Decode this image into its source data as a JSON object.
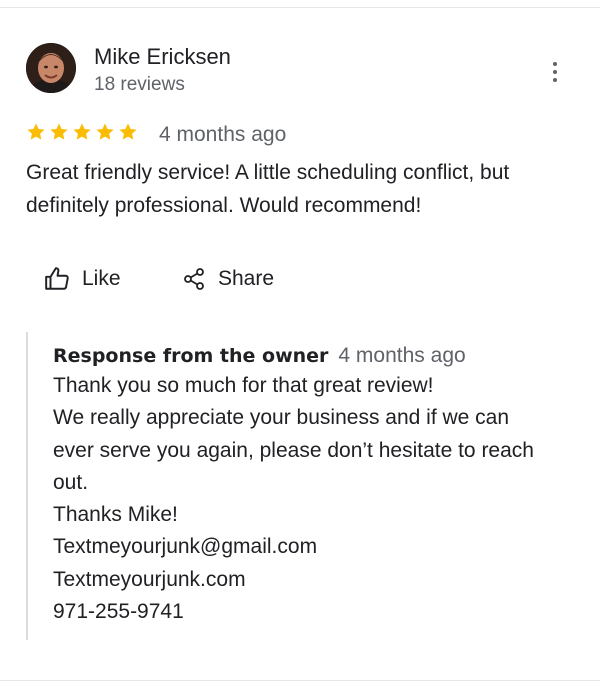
{
  "review": {
    "reviewer": {
      "name": "Mike Ericksen",
      "review_count": "18 reviews"
    },
    "rating": 5,
    "time": "4 months ago",
    "text_lines": [
      "Great friendly service! A little scheduling conflict, but",
      "definitely professional. Would recommend!"
    ]
  },
  "actions": {
    "like_label": "Like",
    "share_label": "Share"
  },
  "owner_response": {
    "title": "Response from the owner",
    "time": "4 months ago",
    "lines": [
      "Thank you so much for that great review!",
      "We really appreciate your business and if we can",
      "ever serve you again, please don’t hesitate to reach",
      "out.",
      "Thanks Mike!",
      "Textmeyourjunk@gmail.com",
      "Textmeyourjunk.com",
      "971-255-9741"
    ]
  },
  "icons": [
    "more-vert-icon",
    "star-icon",
    "thumb-up-icon",
    "share-icon"
  ],
  "colors": {
    "star": "#fbbc04",
    "secondary_text": "#5f6368",
    "divider": "#dadce0"
  }
}
